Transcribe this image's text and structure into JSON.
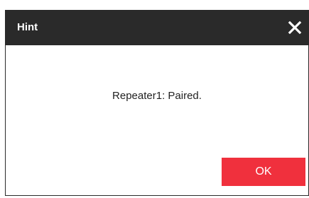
{
  "dialog": {
    "title": "Hint",
    "close_icon": "close-icon",
    "message": "Repeater1: Paired.",
    "ok_label": "OK"
  },
  "colors": {
    "titlebar_bg": "#2a2a2a",
    "title_text": "#ffffff",
    "ok_button_bg": "#f0303d",
    "ok_button_text": "#ffffff",
    "message_text": "#222222"
  }
}
